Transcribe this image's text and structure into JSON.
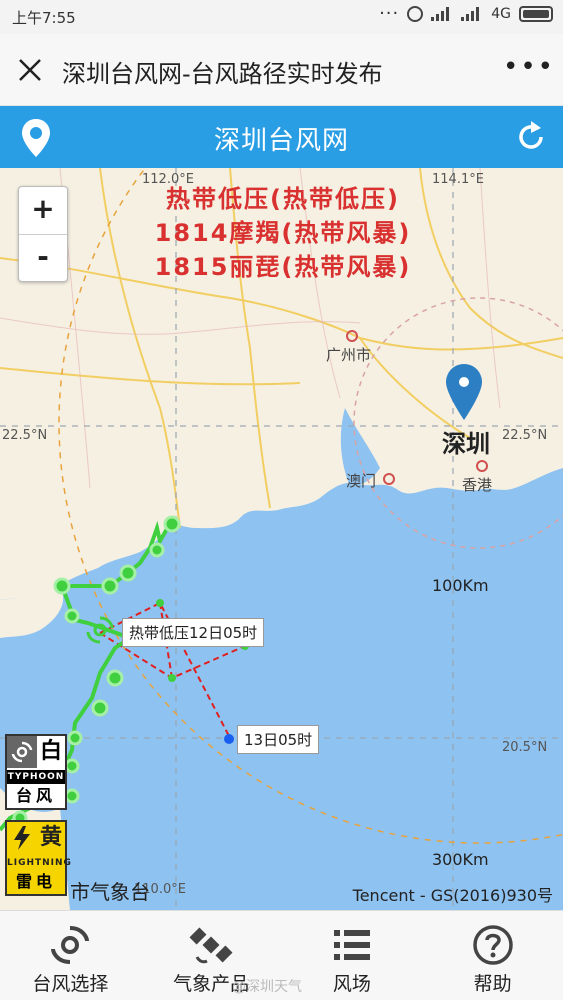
{
  "status_bar": {
    "time": "上午7:55",
    "network": "4G"
  },
  "title_bar": {
    "title": "深圳台风网-台风路径实时发布"
  },
  "app_header": {
    "title": "深圳台风网"
  },
  "map": {
    "zoom_in": "+",
    "zoom_out": "-",
    "storms": [
      "热带低压(热带低压)",
      "1814摩羯(热带风暴)",
      "1815丽琵(热带风暴)"
    ],
    "grid_labels": {
      "lon_112": "112.0°E",
      "lon_114": "114.1°E",
      "lat_225_left": "22.5°N",
      "lat_225_right": "22.5°N",
      "lat_205": "20.5°N",
      "lon_bottom": "110.0°E"
    },
    "cities": {
      "guangzhou": "广州市",
      "macau": "澳门",
      "hongkong": "香港",
      "shenzhen": "深圳"
    },
    "distances": {
      "d100": "100Km",
      "d300": "300Km"
    },
    "storm_label": "热带低压12日05时",
    "forecast_label": "13日05时",
    "source": "市气象台",
    "copyright": "Tencent - GS(2016)930号",
    "colors": {
      "sea": "#8ec2f0",
      "land": "#f5f0e2",
      "track": "#3fcf3f",
      "forecast": "#e02020",
      "header": "#2a9ee4"
    }
  },
  "warnings": [
    {
      "level": "白",
      "english": "TYPHOON",
      "chinese": "台风",
      "icon": "typhoon-icon"
    },
    {
      "level": "黄",
      "english": "LIGHTNING",
      "chinese": "雷电",
      "icon": "lightning-icon"
    }
  ],
  "bottom_nav": {
    "items": [
      {
        "label": "台风选择",
        "icon": "typhoon-icon"
      },
      {
        "label": "气象产品",
        "icon": "satellite-icon"
      },
      {
        "label": "风场",
        "icon": "list-icon"
      },
      {
        "label": "帮助",
        "icon": "help-icon"
      }
    ],
    "watermark": "@深圳天气"
  }
}
